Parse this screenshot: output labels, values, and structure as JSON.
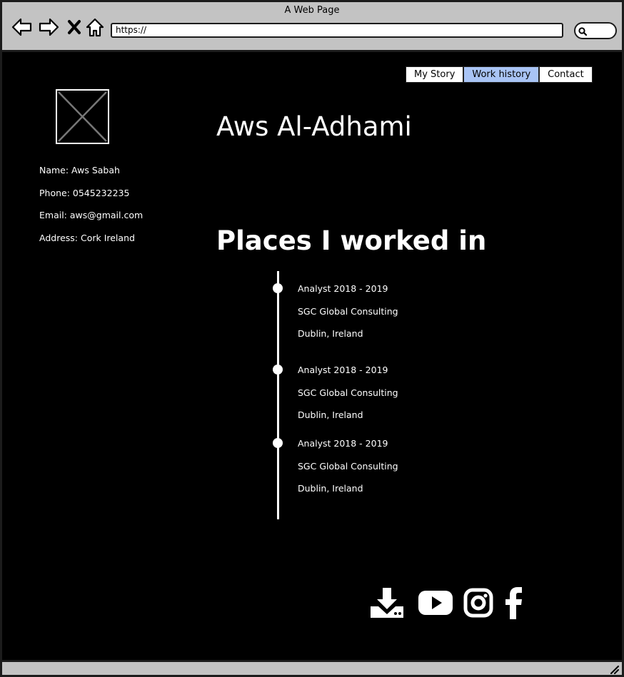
{
  "window": {
    "title": "A Web Page"
  },
  "browser": {
    "address": "https://",
    "nav_icons": [
      "back-arrow-icon",
      "forward-arrow-icon",
      "close-x-icon",
      "home-icon"
    ],
    "search_icon": "magnifier-icon"
  },
  "nav": {
    "tabs": [
      {
        "label": "My Story",
        "active": false
      },
      {
        "label": "Work history",
        "active": true
      },
      {
        "label": "Contact",
        "active": false
      }
    ]
  },
  "profile": {
    "name": "Aws Al-Adhami",
    "image": "image-placeholder",
    "info": [
      "Name: Aws Sabah",
      "Phone: 0545232235",
      "Email: aws@gmail.com",
      "Address: Cork Ireland"
    ]
  },
  "work": {
    "title": "Places I worked in",
    "entries": [
      {
        "role": "Analyst 2018 - 2019",
        "company": "SGC Global Consulting",
        "location": "Dublin, Ireland"
      },
      {
        "role": "Analyst 2018 - 2019",
        "company": "SGC Global Consulting",
        "location": "Dublin, Ireland"
      },
      {
        "role": "Analyst 2018 - 2019",
        "company": "SGC Global Consulting",
        "location": "Dublin, Ireland"
      }
    ]
  },
  "social": {
    "icons": [
      "download-icon",
      "youtube-icon",
      "instagram-icon",
      "facebook-icon"
    ]
  },
  "colors": {
    "page_background": "#000000",
    "chrome": "#c3c3c3",
    "active_tab": "#a9c4f5",
    "text": "#ffffff"
  }
}
